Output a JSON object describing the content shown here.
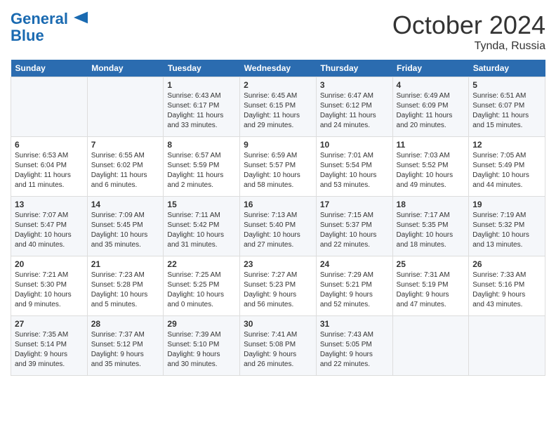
{
  "logo": {
    "line1": "General",
    "line2": "Blue"
  },
  "title": "October 2024",
  "location": "Tynda, Russia",
  "days_header": [
    "Sunday",
    "Monday",
    "Tuesday",
    "Wednesday",
    "Thursday",
    "Friday",
    "Saturday"
  ],
  "weeks": [
    [
      {
        "day": "",
        "info": ""
      },
      {
        "day": "",
        "info": ""
      },
      {
        "day": "1",
        "info": "Sunrise: 6:43 AM\nSunset: 6:17 PM\nDaylight: 11 hours\nand 33 minutes."
      },
      {
        "day": "2",
        "info": "Sunrise: 6:45 AM\nSunset: 6:15 PM\nDaylight: 11 hours\nand 29 minutes."
      },
      {
        "day": "3",
        "info": "Sunrise: 6:47 AM\nSunset: 6:12 PM\nDaylight: 11 hours\nand 24 minutes."
      },
      {
        "day": "4",
        "info": "Sunrise: 6:49 AM\nSunset: 6:09 PM\nDaylight: 11 hours\nand 20 minutes."
      },
      {
        "day": "5",
        "info": "Sunrise: 6:51 AM\nSunset: 6:07 PM\nDaylight: 11 hours\nand 15 minutes."
      }
    ],
    [
      {
        "day": "6",
        "info": "Sunrise: 6:53 AM\nSunset: 6:04 PM\nDaylight: 11 hours\nand 11 minutes."
      },
      {
        "day": "7",
        "info": "Sunrise: 6:55 AM\nSunset: 6:02 PM\nDaylight: 11 hours\nand 6 minutes."
      },
      {
        "day": "8",
        "info": "Sunrise: 6:57 AM\nSunset: 5:59 PM\nDaylight: 11 hours\nand 2 minutes."
      },
      {
        "day": "9",
        "info": "Sunrise: 6:59 AM\nSunset: 5:57 PM\nDaylight: 10 hours\nand 58 minutes."
      },
      {
        "day": "10",
        "info": "Sunrise: 7:01 AM\nSunset: 5:54 PM\nDaylight: 10 hours\nand 53 minutes."
      },
      {
        "day": "11",
        "info": "Sunrise: 7:03 AM\nSunset: 5:52 PM\nDaylight: 10 hours\nand 49 minutes."
      },
      {
        "day": "12",
        "info": "Sunrise: 7:05 AM\nSunset: 5:49 PM\nDaylight: 10 hours\nand 44 minutes."
      }
    ],
    [
      {
        "day": "13",
        "info": "Sunrise: 7:07 AM\nSunset: 5:47 PM\nDaylight: 10 hours\nand 40 minutes."
      },
      {
        "day": "14",
        "info": "Sunrise: 7:09 AM\nSunset: 5:45 PM\nDaylight: 10 hours\nand 35 minutes."
      },
      {
        "day": "15",
        "info": "Sunrise: 7:11 AM\nSunset: 5:42 PM\nDaylight: 10 hours\nand 31 minutes."
      },
      {
        "day": "16",
        "info": "Sunrise: 7:13 AM\nSunset: 5:40 PM\nDaylight: 10 hours\nand 27 minutes."
      },
      {
        "day": "17",
        "info": "Sunrise: 7:15 AM\nSunset: 5:37 PM\nDaylight: 10 hours\nand 22 minutes."
      },
      {
        "day": "18",
        "info": "Sunrise: 7:17 AM\nSunset: 5:35 PM\nDaylight: 10 hours\nand 18 minutes."
      },
      {
        "day": "19",
        "info": "Sunrise: 7:19 AM\nSunset: 5:32 PM\nDaylight: 10 hours\nand 13 minutes."
      }
    ],
    [
      {
        "day": "20",
        "info": "Sunrise: 7:21 AM\nSunset: 5:30 PM\nDaylight: 10 hours\nand 9 minutes."
      },
      {
        "day": "21",
        "info": "Sunrise: 7:23 AM\nSunset: 5:28 PM\nDaylight: 10 hours\nand 5 minutes."
      },
      {
        "day": "22",
        "info": "Sunrise: 7:25 AM\nSunset: 5:25 PM\nDaylight: 10 hours\nand 0 minutes."
      },
      {
        "day": "23",
        "info": "Sunrise: 7:27 AM\nSunset: 5:23 PM\nDaylight: 9 hours\nand 56 minutes."
      },
      {
        "day": "24",
        "info": "Sunrise: 7:29 AM\nSunset: 5:21 PM\nDaylight: 9 hours\nand 52 minutes."
      },
      {
        "day": "25",
        "info": "Sunrise: 7:31 AM\nSunset: 5:19 PM\nDaylight: 9 hours\nand 47 minutes."
      },
      {
        "day": "26",
        "info": "Sunrise: 7:33 AM\nSunset: 5:16 PM\nDaylight: 9 hours\nand 43 minutes."
      }
    ],
    [
      {
        "day": "27",
        "info": "Sunrise: 7:35 AM\nSunset: 5:14 PM\nDaylight: 9 hours\nand 39 minutes."
      },
      {
        "day": "28",
        "info": "Sunrise: 7:37 AM\nSunset: 5:12 PM\nDaylight: 9 hours\nand 35 minutes."
      },
      {
        "day": "29",
        "info": "Sunrise: 7:39 AM\nSunset: 5:10 PM\nDaylight: 9 hours\nand 30 minutes."
      },
      {
        "day": "30",
        "info": "Sunrise: 7:41 AM\nSunset: 5:08 PM\nDaylight: 9 hours\nand 26 minutes."
      },
      {
        "day": "31",
        "info": "Sunrise: 7:43 AM\nSunset: 5:05 PM\nDaylight: 9 hours\nand 22 minutes."
      },
      {
        "day": "",
        "info": ""
      },
      {
        "day": "",
        "info": ""
      }
    ]
  ]
}
